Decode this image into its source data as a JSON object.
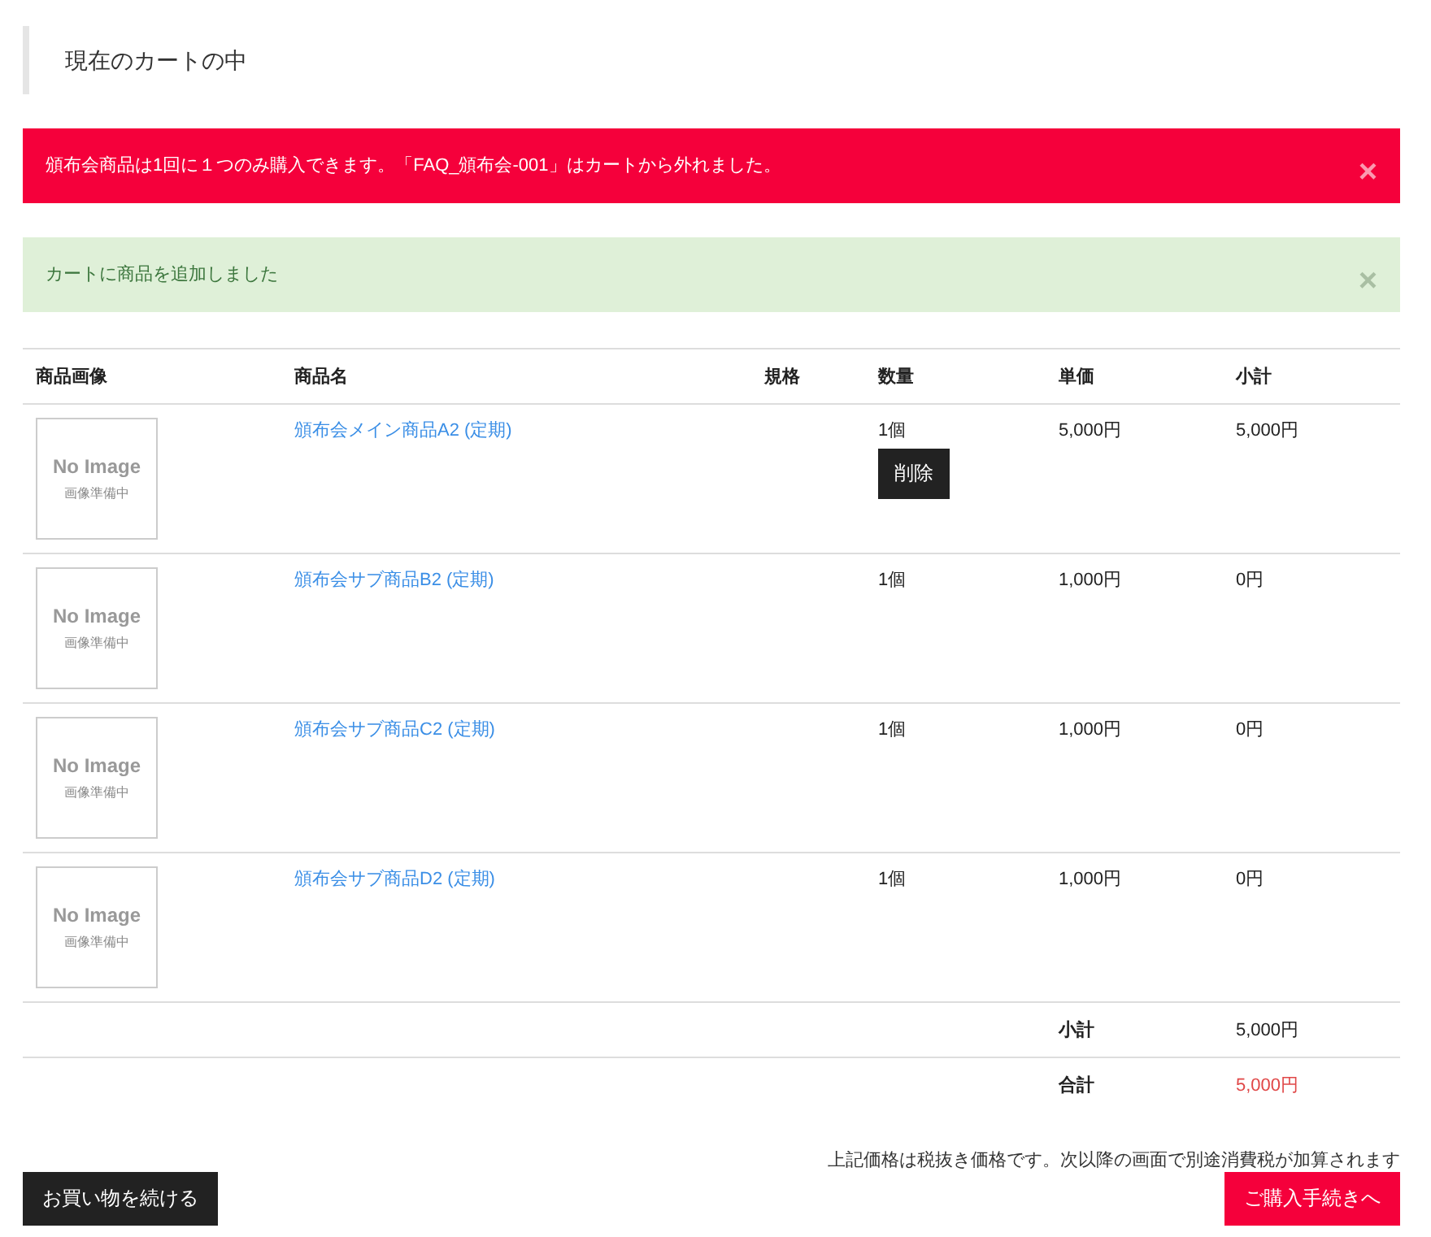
{
  "heading": "現在のカートの中",
  "alerts": [
    {
      "kind": "error",
      "text": "頒布会商品は1回に１つのみ購入できます。「FAQ_頒布会-001」はカートから外れました。",
      "close": "×"
    },
    {
      "kind": "success",
      "text": "カートに商品を追加しました",
      "close": "×"
    }
  ],
  "table": {
    "columns": [
      "商品画像",
      "商品名",
      "規格",
      "数量",
      "単価",
      "小計"
    ],
    "rows": [
      {
        "image_title": "No Image",
        "image_caption": "画像準備中",
        "name": "頒布会メイン商品A2 (定期)",
        "spec": "",
        "quantity": "1個",
        "delete": "削除",
        "unit_price": "5,000円",
        "subtotal": "5,000円"
      },
      {
        "image_title": "No Image",
        "image_caption": "画像準備中",
        "name": "頒布会サブ商品B2 (定期)",
        "quantity": "1個",
        "unit_price": "1,000円",
        "subtotal": "0円"
      },
      {
        "image_title": "No Image",
        "image_caption": "画像準備中",
        "name": "頒布会サブ商品C2 (定期)",
        "quantity": "1個",
        "unit_price": "1,000円",
        "subtotal": "0円"
      },
      {
        "image_title": "No Image",
        "image_caption": "画像準備中",
        "name": "頒布会サブ商品D2 (定期)",
        "quantity": "1個",
        "unit_price": "1,000円",
        "subtotal": "0円"
      }
    ],
    "summary": [
      {
        "kind": "subtotal",
        "label": "小計",
        "value": "5,000円"
      },
      {
        "kind": "total",
        "label": "合計",
        "value": "5,000円"
      }
    ]
  },
  "tax_note": "上記価格は税抜き価格です。次以降の画面で別途消費税が加算されます",
  "buttons": {
    "continue": "お買い物を続ける",
    "checkout": "ご購入手続きへ"
  }
}
